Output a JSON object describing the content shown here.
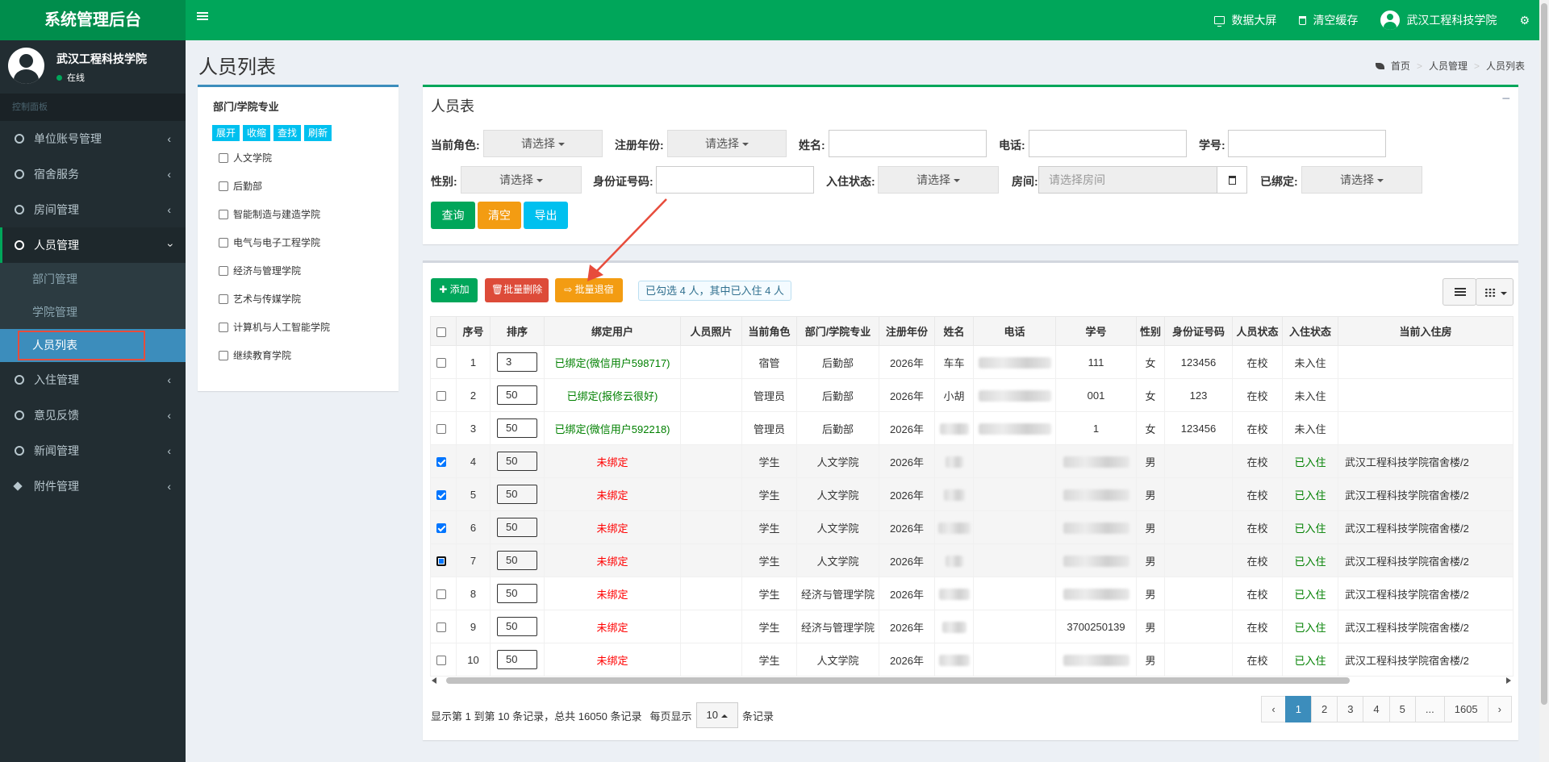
{
  "header": {
    "logo": "系统管理后台",
    "data_screen": "数据大屏",
    "clear_cache": "清空缓存",
    "user_name": "武汉工程科技学院"
  },
  "sidebar": {
    "profile_name": "武汉工程科技学院",
    "profile_status": "在线",
    "section_header": "控制面板",
    "items": [
      {
        "label": "单位账号管理"
      },
      {
        "label": "宿舍服务"
      },
      {
        "label": "房间管理"
      },
      {
        "label": "人员管理"
      },
      {
        "label": "入住管理"
      },
      {
        "label": "意见反馈"
      },
      {
        "label": "新闻管理"
      },
      {
        "label": "附件管理"
      }
    ],
    "sub_items": [
      {
        "label": "部门管理"
      },
      {
        "label": "学院管理"
      },
      {
        "label": "人员列表"
      }
    ]
  },
  "page": {
    "title": "人员列表",
    "breadcrumb": [
      "首页",
      "人员管理",
      "人员列表"
    ]
  },
  "tree": {
    "title": "部门/学院专业",
    "buttons": [
      "展开",
      "收缩",
      "查找",
      "刷新"
    ],
    "items": [
      "人文学院",
      "后勤部",
      "智能制造与建造学院",
      "电气与电子工程学院",
      "经济与管理学院",
      "艺术与传媒学院",
      "计算机与人工智能学院",
      "继续教育学院"
    ]
  },
  "filters": {
    "box_title": "人员表",
    "collapse_icon": "−",
    "role_label": "当前角色:",
    "role_value": "请选择",
    "year_label": "注册年份:",
    "year_value": "请选择",
    "name_label": "姓名:",
    "phone_label": "电话:",
    "sid_label": "学号:",
    "gender_label": "性别:",
    "gender_value": "请选择",
    "idcard_label": "身份证号码:",
    "checkin_label": "入住状态:",
    "checkin_value": "请选择",
    "room_label": "房间:",
    "room_placeholder": "请选择房间",
    "bound_label": "已绑定:",
    "bound_value": "请选择",
    "query_btn": "查询",
    "clear_btn": "清空",
    "export_btn": "导出"
  },
  "toolbar": {
    "add": "✚ 添加",
    "batch_delete": "🗑批量删除",
    "batch_checkout": "⇨ 批量退宿",
    "selected_info": "已勾选 4 人，其中已入住 4 人"
  },
  "table": {
    "columns": [
      "",
      "序号",
      "排序",
      "绑定用户",
      "人员照片",
      "当前角色",
      "部门/学院专业",
      "注册年份",
      "姓名",
      "电话",
      "学号",
      "性别",
      "身份证号码",
      "人员状态",
      "入住状态",
      "当前入住房"
    ],
    "rows": [
      {
        "checked": false,
        "no": "1",
        "sort": "3",
        "bind": "已绑定(微信用户598717)",
        "bound": true,
        "role": "宿管",
        "dept": "后勤部",
        "year": "2026年",
        "name": "车车",
        "phone_blur": true,
        "sid": "111",
        "gender": "女",
        "idcard": "123456",
        "status": "在校",
        "checkin": "未入住",
        "room": ""
      },
      {
        "checked": false,
        "no": "2",
        "sort": "50",
        "bind": "已绑定(报修云很好)",
        "bound": true,
        "role": "管理员",
        "dept": "后勤部",
        "year": "2026年",
        "name": "小胡",
        "phone_blur": true,
        "sid": "001",
        "gender": "女",
        "idcard": "123",
        "status": "在校",
        "checkin": "未入住",
        "room": ""
      },
      {
        "checked": false,
        "no": "3",
        "sort": "50",
        "bind": "已绑定(微信用户592218)",
        "bound": true,
        "role": "管理员",
        "dept": "后勤部",
        "year": "2026年",
        "name": "",
        "phone_blur": true,
        "sid": "1",
        "gender": "女",
        "idcard": "123456",
        "status": "在校",
        "checkin": "未入住",
        "room": ""
      },
      {
        "checked": true,
        "no": "4",
        "sort": "50",
        "bind": "未绑定",
        "bound": false,
        "role": "学生",
        "dept": "人文学院",
        "year": "2026年",
        "name": "",
        "phone_blur": false,
        "sid": "",
        "gender": "男",
        "idcard": "",
        "status": "在校",
        "checkin": "已入住",
        "room": "武汉工程科技学院宿舍楼/2"
      },
      {
        "checked": true,
        "no": "5",
        "sort": "50",
        "bind": "未绑定",
        "bound": false,
        "role": "学生",
        "dept": "人文学院",
        "year": "2026年",
        "name": "",
        "phone_blur": false,
        "sid": "",
        "gender": "男",
        "idcard": "",
        "status": "在校",
        "checkin": "已入住",
        "room": "武汉工程科技学院宿舍楼/2"
      },
      {
        "checked": true,
        "no": "6",
        "sort": "50",
        "bind": "未绑定",
        "bound": false,
        "role": "学生",
        "dept": "人文学院",
        "year": "2026年",
        "name": "",
        "phone_blur": false,
        "sid": "",
        "gender": "男",
        "idcard": "",
        "status": "在校",
        "checkin": "已入住",
        "room": "武汉工程科技学院宿舍楼/2"
      },
      {
        "checked": true,
        "focus": true,
        "no": "7",
        "sort": "50",
        "bind": "未绑定",
        "bound": false,
        "role": "学生",
        "dept": "人文学院",
        "year": "2026年",
        "name": "",
        "phone_blur": false,
        "sid": "",
        "gender": "男",
        "idcard": "",
        "status": "在校",
        "checkin": "已入住",
        "room": "武汉工程科技学院宿舍楼/2"
      },
      {
        "checked": false,
        "no": "8",
        "sort": "50",
        "bind": "未绑定",
        "bound": false,
        "role": "学生",
        "dept": "经济与管理学院",
        "year": "2026年",
        "name": "",
        "phone_blur": false,
        "sid": "",
        "gender": "男",
        "idcard": "",
        "status": "在校",
        "checkin": "已入住",
        "room": "武汉工程科技学院宿舍楼/2"
      },
      {
        "checked": false,
        "no": "9",
        "sort": "50",
        "bind": "未绑定",
        "bound": false,
        "role": "学生",
        "dept": "经济与管理学院",
        "year": "2026年",
        "name": "",
        "phone_blur": false,
        "sid": "3700250139",
        "gender": "男",
        "idcard": "",
        "status": "在校",
        "checkin": "已入住",
        "room": "武汉工程科技学院宿舍楼/2"
      },
      {
        "checked": false,
        "no": "10",
        "sort": "50",
        "bind": "未绑定",
        "bound": false,
        "role": "学生",
        "dept": "人文学院",
        "year": "2026年",
        "name": "",
        "phone_blur": false,
        "sid": "",
        "gender": "男",
        "idcard": "",
        "status": "在校",
        "checkin": "已入住",
        "room": "武汉工程科技学院宿舍楼/2"
      }
    ]
  },
  "footer": {
    "summary": "显示第 1 到第 10 条记录，总共 16050 条记录",
    "per_page_prefix": "每页显示",
    "per_page": "10",
    "per_page_suffix": "条记录",
    "pages": [
      "‹",
      "1",
      "2",
      "3",
      "4",
      "5",
      "...",
      "1605",
      "›"
    ],
    "current_page": "1"
  },
  "colors": {
    "brand": "#00a65a",
    "danger": "#dd4b39",
    "warning": "#f39c12",
    "info": "#00c0ef",
    "primary": "#3c8dbc",
    "annotation": "#e74c3c"
  }
}
